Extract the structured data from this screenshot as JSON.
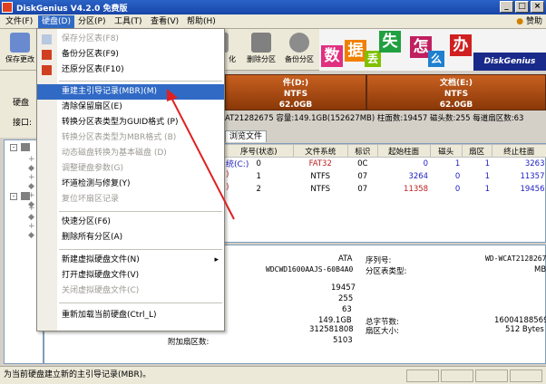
{
  "window": {
    "title": "DiskGenius V4.2.0 免费版"
  },
  "menubar": {
    "items": [
      "文件(F)",
      "硬盘(D)",
      "分区(P)",
      "工具(T)",
      "查看(V)",
      "帮助(H)"
    ],
    "help_link": "赞助"
  },
  "toolbar": {
    "save": "保存更改",
    "btn2": "化",
    "delete": "删除分区",
    "backup": "备份分区"
  },
  "banner": {
    "chars": [
      "数",
      "据",
      "丢",
      "失",
      "怎",
      "么",
      "办"
    ],
    "brand": "DiskGenius"
  },
  "left_panel": {
    "disk_label": "硬盘",
    "disk_value": "0",
    "iface_label": "接口:",
    "iface_value": "AT"
  },
  "disk_bar": {
    "p1": {
      "line1": "件(D:)",
      "line2": "NTFS",
      "line3": "62.0GB",
      "color": "#b05010"
    },
    "p2": {
      "line1": "文档(E:)",
      "line2": "NTFS",
      "line3": "62.0GB",
      "color": "#b05010"
    }
  },
  "disk_info": "AT21282675  容量:149.1GB(152627MB)  柱面数:19457  磁头数:255  每道扇区数:63",
  "tab_label": "浏览文件",
  "table": {
    "headers": [
      "序号(状态)",
      "文件系统",
      "标识",
      "起始柱面",
      "磁头",
      "扇区",
      "终止柱面"
    ],
    "rows": [
      {
        "name": "统(C:)",
        "idx": "0",
        "fs": "FAT32",
        "id": "0C",
        "start": "0",
        "head": "1",
        "sec": "1",
        "end": "3263"
      },
      {
        "name": ")",
        "idx": "1",
        "fs": "NTFS",
        "id": "07",
        "start": "3264",
        "head": "0",
        "sec": "1",
        "end": "11357"
      },
      {
        "name": ")",
        "idx": "2",
        "fs": "NTFS",
        "id": "07",
        "start": "11358",
        "head": "0",
        "sec": "1",
        "end": "19456"
      }
    ]
  },
  "details": {
    "iface": "ATA",
    "model": "WDCWD1600AAJS-60B4A0",
    "serial_label": "序列号:",
    "serial_value": "WD-WCAT2128267",
    "ptable_label": "分区表类型:",
    "ptable_value": "MBR",
    "cyl": "19457",
    "heads": "255",
    "spt": "63",
    "capacity": "149.1GB",
    "total_bytes_label": "总字节数:",
    "total_bytes_value": "160041885696",
    "sectors": "312581808",
    "sector_size_label": "扇区大小:",
    "sector_size_value": "512 Bytes",
    "extra_label": "附加扇区数:",
    "extra_value": "5103"
  },
  "status": {
    "text": "为当前硬盘建立新的主引导记录(MBR)。"
  },
  "dropdown": {
    "items": [
      {
        "label": "保存分区表(F8)",
        "disabled": true
      },
      {
        "label": "备份分区表(F9)",
        "disabled": false
      },
      {
        "label": "还原分区表(F10)",
        "disabled": false
      },
      {
        "label": "重建主引导记录(MBR)(M)",
        "disabled": false,
        "highlight": true
      },
      {
        "label": "清除保留扇区(E)",
        "disabled": false
      },
      {
        "label": "转换分区表类型为GUID格式 (P)",
        "disabled": false
      },
      {
        "label": "转换分区表类型为MBR格式 (B)",
        "disabled": true
      },
      {
        "label": "动态磁盘转换为基本磁盘 (D)",
        "disabled": true
      },
      {
        "label": "调整硬盘参数(G)",
        "disabled": true
      },
      {
        "label": "坏道检测与修复(Y)",
        "disabled": false
      },
      {
        "label": "复位坏扇区记录",
        "disabled": true
      },
      {
        "label": "快速分区(F6)",
        "disabled": false
      },
      {
        "label": "删除所有分区(A)",
        "disabled": false
      },
      {
        "label": "新建虚拟硬盘文件(N)",
        "disabled": false,
        "submenu": true
      },
      {
        "label": "打开虚拟硬盘文件(V)",
        "disabled": false
      },
      {
        "label": "关闭虚拟硬盘文件(C)",
        "disabled": true
      },
      {
        "label": "重新加载当前硬盘(Ctrl_L)",
        "disabled": false
      }
    ]
  },
  "colors": {
    "highlight": "#316ac5",
    "arrow": "#e02020"
  }
}
